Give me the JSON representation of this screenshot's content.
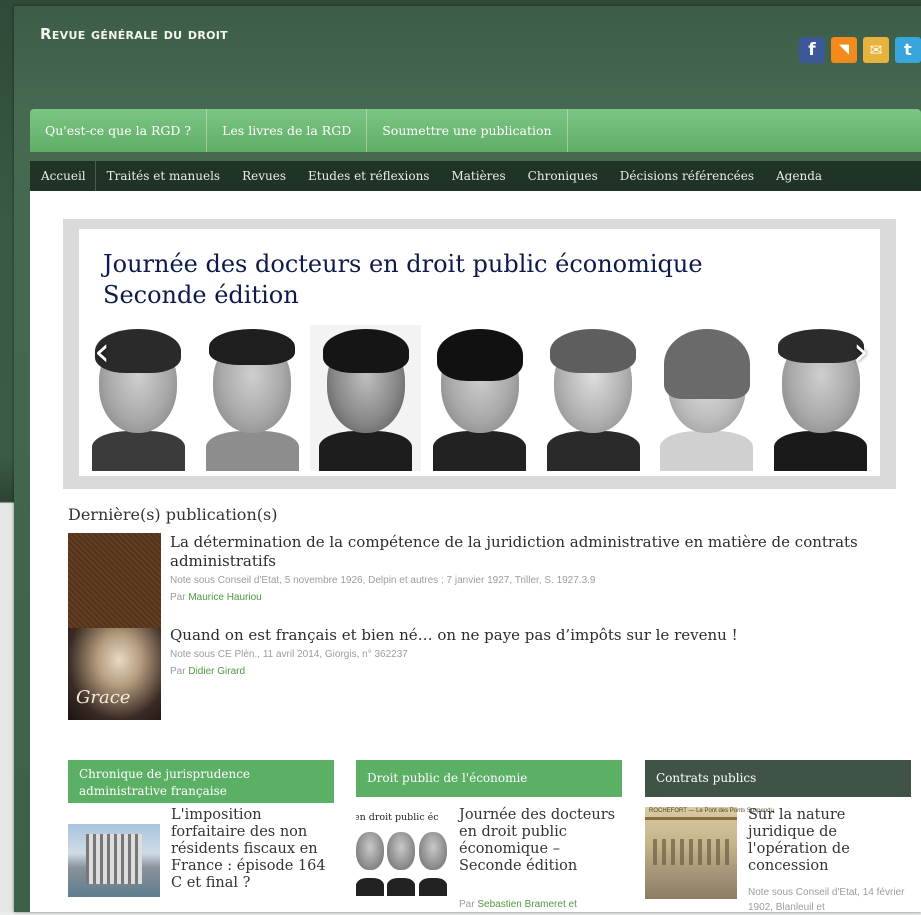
{
  "site": {
    "title": "Revue générale du droit"
  },
  "social": [
    {
      "icon": "facebook-icon",
      "glyph": "f"
    },
    {
      "icon": "rss-icon",
      "glyph": "◥"
    },
    {
      "icon": "mail-icon",
      "glyph": "✉"
    },
    {
      "icon": "twitter-icon",
      "glyph": "t"
    }
  ],
  "topnav": [
    {
      "label": "Qu'est-ce que la RGD ?"
    },
    {
      "label": "Les livres de la RGD"
    },
    {
      "label": "Soumettre une publication"
    }
  ],
  "mainnav": [
    {
      "label": "Accueil"
    },
    {
      "label": "Traités et manuels"
    },
    {
      "label": "Revues"
    },
    {
      "label": "Etudes et réflexions"
    },
    {
      "label": "Matières"
    },
    {
      "label": "Chroniques"
    },
    {
      "label": "Décisions référencées"
    },
    {
      "label": "Agenda"
    }
  ],
  "slider": {
    "title_line1": "Journée des docteurs en droit public économique",
    "title_line2": "Seconde édition",
    "prev": "‹",
    "next": "›"
  },
  "latest": {
    "heading": "Dernière(s) publication(s)",
    "items": [
      {
        "title": "La détermination de la compétence de la juridiction administrative en matière de contrats administratifs",
        "note": "Note sous Conseil d'Etat, 5 novembre 1926, Delpin et autres ; 7 janvier 1927, Triller, S. 1927.3.9",
        "by": "Par",
        "author": "Maurice Hauriou"
      },
      {
        "title": "Quand on est français et bien né… on ne paye pas d’impôts sur le revenu !",
        "note": "Note sous CE Plén., 11 avril 2014, Giorgis, n° 362237",
        "by": "Par",
        "author": "Didier Girard",
        "thumb_text": "Grace"
      }
    ]
  },
  "cards": [
    {
      "header": "Chronique de jurisprudence administrative française",
      "title": "L'imposition forfaitaire des non résidents fiscaux en France : épisode 164 C et final ?"
    },
    {
      "header": "Droit public de l'économie",
      "title": "Journée des docteurs en droit public économique – Seconde édition",
      "by": "Par",
      "author": "Sebastien Brameret et",
      "thumb_text": "en droit public éc"
    },
    {
      "header": "Contrats publics",
      "title": "Sur la nature juridique de l'opération de concession",
      "note": "Note sous Conseil d'Etat, 14 février 1902, Blanleuil et",
      "thumb_text": "ROCHEFORT — Le Pont des Ponts Suspendu"
    }
  ]
}
